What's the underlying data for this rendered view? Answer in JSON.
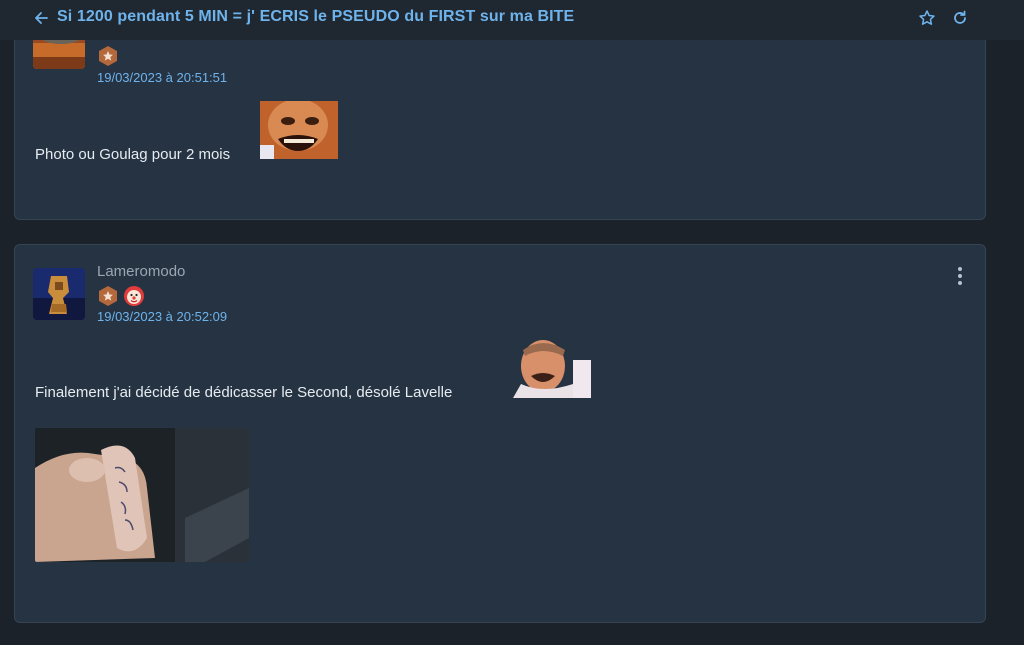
{
  "topbar": {
    "title": "Si 1200 pendant 5 MIN = j' ECRIS le PSEUDO du FIRST sur ma BITE",
    "back_icon": "arrow-left-icon",
    "star_icon": "star-outline-icon",
    "refresh_icon": "refresh-icon",
    "accent_color": "#6fb3ec"
  },
  "posts": [
    {
      "author": "",
      "badges": [
        "bronze-star-badge"
      ],
      "date": "19/03/2023 à 20:51:51",
      "text": "Photo ou Goulag pour 2 mois",
      "sticker": "risitas-laughing-sticker"
    },
    {
      "author": "Lameromodo",
      "badges": [
        "bronze-star-badge",
        "clown-badge"
      ],
      "date": "19/03/2023 à 20:52:09",
      "text": "Finalement j'ai décidé de dédicasser le Second, désolé Lavelle",
      "sticker": "risitas-smiling-sticker",
      "image": "photo-writing-on-finger"
    }
  ]
}
